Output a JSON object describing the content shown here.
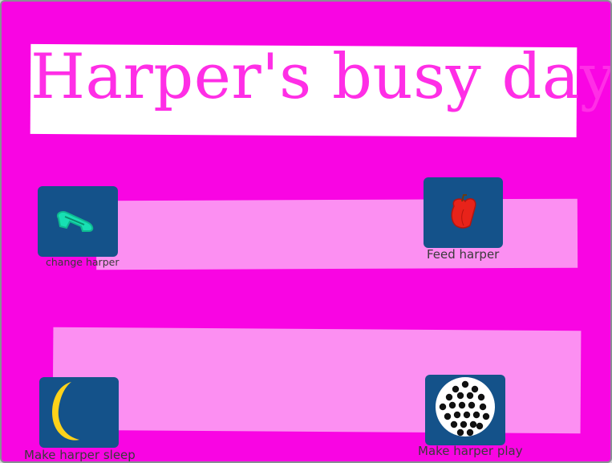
{
  "title": "Harper's busy day",
  "colors": {
    "background": "#f905e3",
    "band": "#fc8ff2",
    "banner": "#ffffff",
    "title_text": "#ff2ee6",
    "sprite_bg": "#14528a",
    "label_text": "#3a3a3a"
  },
  "buttons": [
    {
      "id": "change",
      "label": "change harper",
      "icon": "diaper-icon"
    },
    {
      "id": "feed",
      "label": "Feed harper",
      "icon": "apple-icon"
    },
    {
      "id": "sleep",
      "label": "Make harper sleep",
      "icon": "moon-icon"
    },
    {
      "id": "play",
      "label": "Make harper play",
      "icon": "ball-pit-icon"
    }
  ]
}
